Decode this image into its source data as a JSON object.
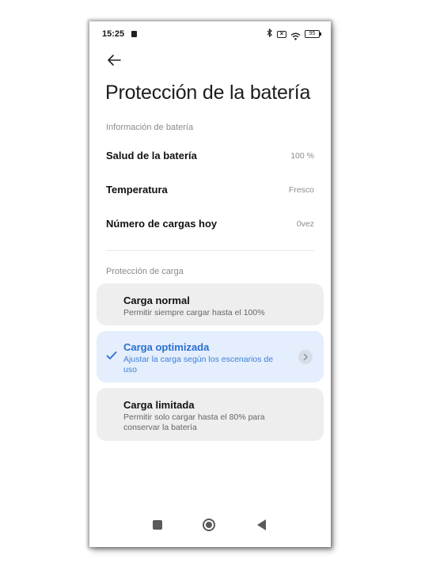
{
  "status_bar": {
    "time": "15:25",
    "battery_level": "95"
  },
  "header": {
    "title": "Protección de la batería"
  },
  "battery_info": {
    "section_label": "Información de batería",
    "rows": [
      {
        "label": "Salud de la batería",
        "value": "100 %"
      },
      {
        "label": "Temperatura",
        "value": "Fresco"
      },
      {
        "label": "Número de cargas hoy",
        "value": "0vez"
      }
    ]
  },
  "charge_protection": {
    "section_label": "Protección de carga",
    "options": [
      {
        "title": "Carga normal",
        "description": "Permitir siempre cargar hasta el 100%",
        "selected": false
      },
      {
        "title": "Carga optimizada",
        "description": "Ajustar la carga según los escenarios de uso",
        "selected": true
      },
      {
        "title": "Carga limitada",
        "description": "Permitir solo cargar hasta el 80% para conservar la batería",
        "selected": false
      }
    ]
  },
  "icons": {
    "back": "back-arrow-icon",
    "bluetooth": "bluetooth-icon",
    "sim": "sim-card-icon",
    "no_sim": "no-sim-icon",
    "wifi": "wifi-icon",
    "battery": "battery-icon",
    "check": "checkmark-icon",
    "chevron": "chevron-right-icon"
  },
  "colors": {
    "accent": "#2a6fd4",
    "selected_card_bg": "#e4eefc",
    "card_bg": "#eeeeee"
  }
}
